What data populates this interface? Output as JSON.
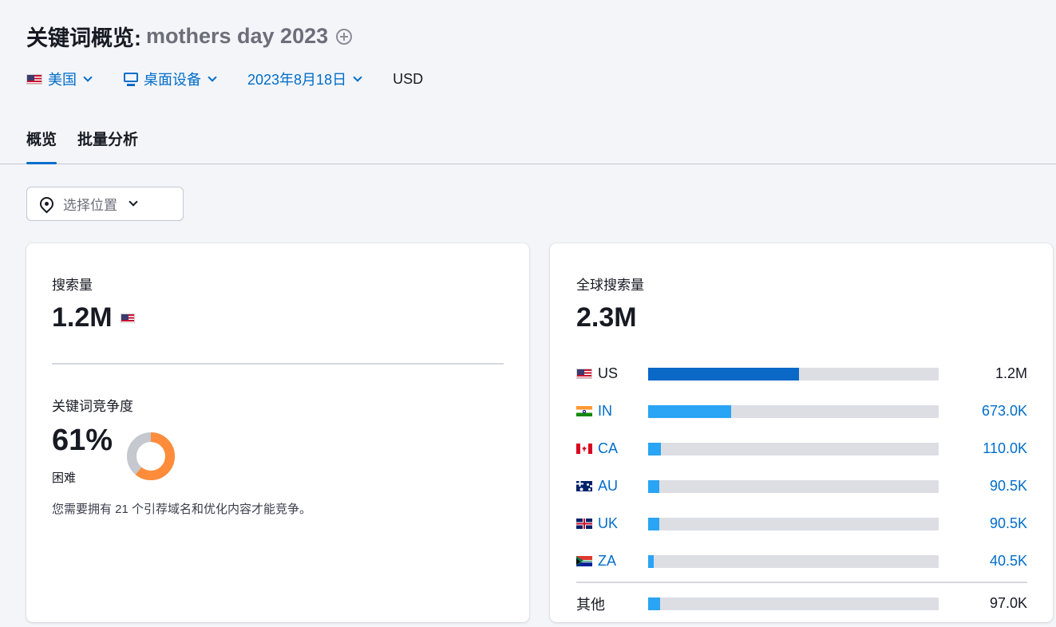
{
  "header": {
    "title_prefix": "关键词概览:",
    "keyword": "mothers day 2023",
    "filters": {
      "country": "美国",
      "device": "桌面设备",
      "date": "2023年8月18日",
      "currency": "USD"
    },
    "tabs": [
      {
        "label": "概览",
        "active": true
      },
      {
        "label": "批量分析",
        "active": false
      }
    ]
  },
  "location_button": {
    "label": "选择位置"
  },
  "search_volume": {
    "label": "搜索量",
    "value": "1.2M"
  },
  "keyword_difficulty": {
    "label": "关键词竞争度",
    "value": "61%",
    "level": "困难",
    "percent": 61,
    "description": "您需要拥有 21 个引荐域名和优化内容才能竞争。",
    "colors": {
      "fill": "#ff8c3a",
      "track": "#c5c8ce"
    }
  },
  "global_volume": {
    "label": "全球搜索量",
    "value": "2.3M",
    "countries": [
      {
        "code": "US",
        "value": "1.2M",
        "share": 0.52,
        "highlight": true
      },
      {
        "code": "IN",
        "value": "673.0K",
        "share": 0.285
      },
      {
        "code": "CA",
        "value": "110.0K",
        "share": 0.045
      },
      {
        "code": "AU",
        "value": "90.5K",
        "share": 0.038
      },
      {
        "code": "UK",
        "value": "90.5K",
        "share": 0.038
      },
      {
        "code": "ZA",
        "value": "40.5K",
        "share": 0.018
      }
    ],
    "other": {
      "label": "其他",
      "value": "97.0K",
      "share": 0.04
    },
    "colors": {
      "primary": "#0a68c7",
      "secondary": "#2aa4f4",
      "track": "#dcdee4"
    }
  }
}
